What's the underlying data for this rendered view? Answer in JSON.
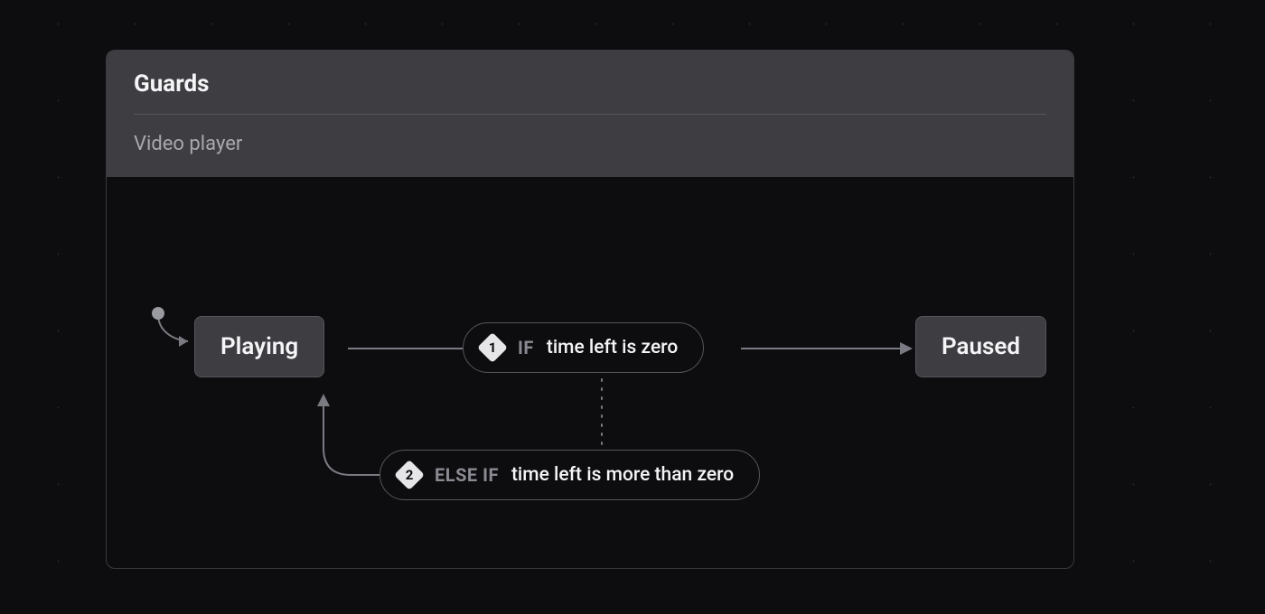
{
  "panel": {
    "title": "Guards",
    "subtitle": "Video player"
  },
  "states": {
    "playing": {
      "label": "Playing"
    },
    "paused": {
      "label": "Paused"
    }
  },
  "guards": [
    {
      "num": "1",
      "keyword": "IF",
      "condition": "time left is zero"
    },
    {
      "num": "2",
      "keyword": "ELSE IF",
      "condition": "time left is more than zero"
    }
  ]
}
